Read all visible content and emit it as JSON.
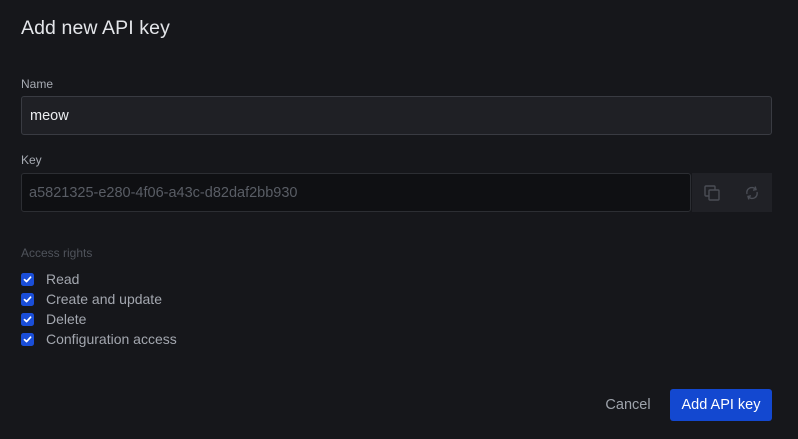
{
  "dialog": {
    "title": "Add new API key"
  },
  "name_field": {
    "label": "Name",
    "value": "meow"
  },
  "key_field": {
    "label": "Key",
    "value": "a5821325-e280-4f06-a43c-d82daf2bb930",
    "copy_icon": "copy-icon",
    "regenerate_icon": "refresh-icon"
  },
  "access": {
    "label": "Access rights",
    "items": [
      {
        "label": "Read",
        "checked": true
      },
      {
        "label": "Create and update",
        "checked": true
      },
      {
        "label": "Delete",
        "checked": true
      },
      {
        "label": "Configuration access",
        "checked": true
      }
    ]
  },
  "actions": {
    "cancel_label": "Cancel",
    "submit_label": "Add API key"
  },
  "colors": {
    "background": "#16171b",
    "accent": "#1348d0",
    "checkbox": "#1a4ed8"
  }
}
